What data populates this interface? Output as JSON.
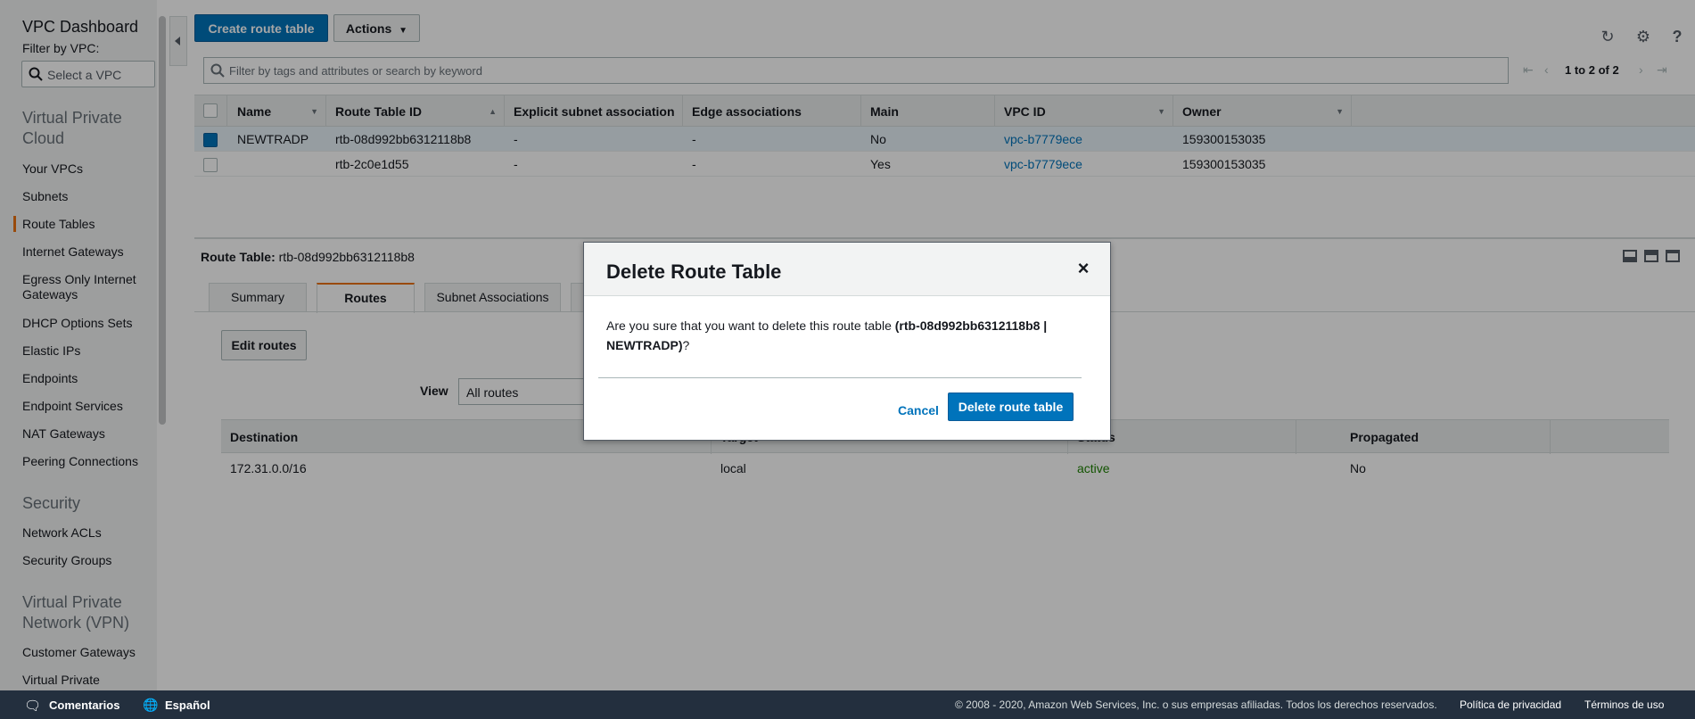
{
  "sidebar": {
    "title": "VPC Dashboard",
    "filter_label": "Filter by VPC:",
    "vpc_select_placeholder": "Select a VPC",
    "sections": [
      {
        "label": "Virtual Private Cloud"
      },
      {
        "label": "Security"
      },
      {
        "label": "Virtual Private Network (VPN)"
      }
    ],
    "links": {
      "your_vpcs": "Your VPCs",
      "subnets": "Subnets",
      "route_tables": "Route Tables",
      "internet_gateways": "Internet Gateways",
      "egress_only": "Egress Only Internet Gateways",
      "dhcp": "DHCP Options Sets",
      "elastic_ips": "Elastic IPs",
      "endpoints": "Endpoints",
      "endpoint_services": "Endpoint Services",
      "nat_gateways": "NAT Gateways",
      "peering": "Peering Connections",
      "network_acls": "Network ACLs",
      "security_groups": "Security Groups",
      "customer_gateways": "Customer Gateways",
      "virtual_private": "Virtual Private"
    },
    "active_item": "Route Tables"
  },
  "toolbar": {
    "create_label": "Create route table",
    "actions_label": "Actions",
    "search_placeholder": "Filter by tags and attributes or search by keyword",
    "pager_text": "1 to 2 of 2",
    "icons": [
      "refresh-icon",
      "gear-icon",
      "help-icon"
    ]
  },
  "route_tables": {
    "columns": [
      "Name",
      "Route Table ID",
      "Explicit subnet association",
      "Edge associations",
      "Main",
      "VPC ID",
      "Owner"
    ],
    "rows": [
      {
        "name": "NEWTRADP",
        "id": "rtb-08d992bb6312118b8",
        "explicit": "-",
        "edge": "-",
        "main": "No",
        "vpc": "vpc-b7779ece",
        "owner": "159300153035",
        "selected": true
      },
      {
        "name": "",
        "id": "rtb-2c0e1d55",
        "explicit": "-",
        "edge": "-",
        "main": "Yes",
        "vpc": "vpc-b7779ece",
        "owner": "159300153035",
        "selected": false
      }
    ]
  },
  "detail": {
    "label": "Route Table:",
    "value": "rtb-08d992bb6312118b8",
    "tabs": [
      "Summary",
      "Routes",
      "Subnet Associations"
    ],
    "active_tab": "Routes",
    "edit_routes_label": "Edit routes",
    "view_label": "View",
    "view_value": "All routes",
    "routes_columns": [
      "Destination",
      "Target",
      "Status",
      "Propagated"
    ],
    "routes": [
      {
        "destination": "172.31.0.0/16",
        "target": "local",
        "status": "active",
        "propagated": "No"
      }
    ]
  },
  "modal": {
    "title": "Delete Route Table",
    "close_symbol": "×",
    "body_prefix": "Are you sure that you want to delete this route table",
    "body_bold": "(rtb-08d992bb6312118b8 | NEWTRADP)",
    "body_suffix": "?",
    "cancel_label": "Cancel",
    "delete_label": "Delete route table"
  },
  "footer": {
    "feedback": "Comentarios",
    "language": "Español",
    "copyright": "© 2008 - 2020, Amazon Web Services, Inc. o sus empresas afiliadas. Todos los derechos reservados.",
    "privacy": "Política de privacidad",
    "terms": "Términos de uso"
  },
  "colors": {
    "accent_orange": "#ec7211",
    "primary_blue": "#0073bb",
    "status_green": "#1d8102",
    "footer_bg": "#232f3e"
  }
}
